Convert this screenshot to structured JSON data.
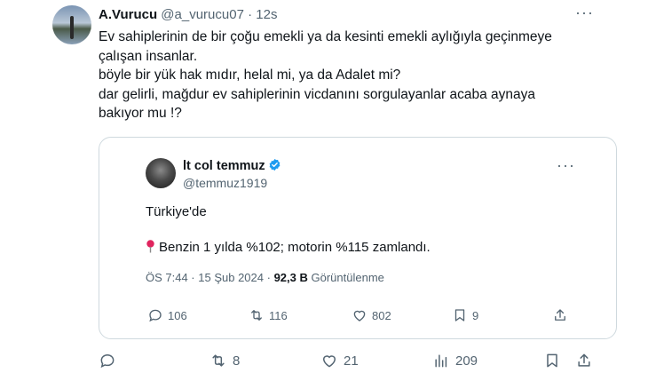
{
  "tweet": {
    "display_name": "A.Vurucu",
    "handle": "@a_vurucu07",
    "separator": "·",
    "time": "12s",
    "more": "···",
    "lines": [
      "Ev sahiplerinin de bir çoğu emekli ya da kesinti emekli aylığıyla geçinmeye",
      "çalışan insanlar.",
      "böyle bir yük hak mıdır, helal mi, ya da Adalet mi?",
      "dar gelirli, mağdur ev sahiplerinin vicdanını sorgulayanlar acaba aynaya",
      "bakıyor mu !?"
    ],
    "actions": {
      "replies": "",
      "retweets": "8",
      "likes": "21",
      "views": "209"
    }
  },
  "quoted": {
    "display_name": "lt col temmuz",
    "handle": "@temmuz1919",
    "more": "···",
    "line1": "Türkiye'de",
    "line2": "Benzin 1 yılda %102; motorin %115 zamlandı.",
    "meta_time": "ÖS 7:44 · 15 Şub 2024 ·",
    "meta_views": "92,3 B",
    "meta_views_label": "Görüntülenme",
    "actions": {
      "replies": "106",
      "retweets": "116",
      "likes": "802",
      "bookmarks": "9"
    }
  },
  "colors": {
    "text": "#0f1419",
    "muted": "#536471",
    "border": "#cfd9de",
    "verified": "#1d9bf0",
    "pin": "#e0245e"
  }
}
